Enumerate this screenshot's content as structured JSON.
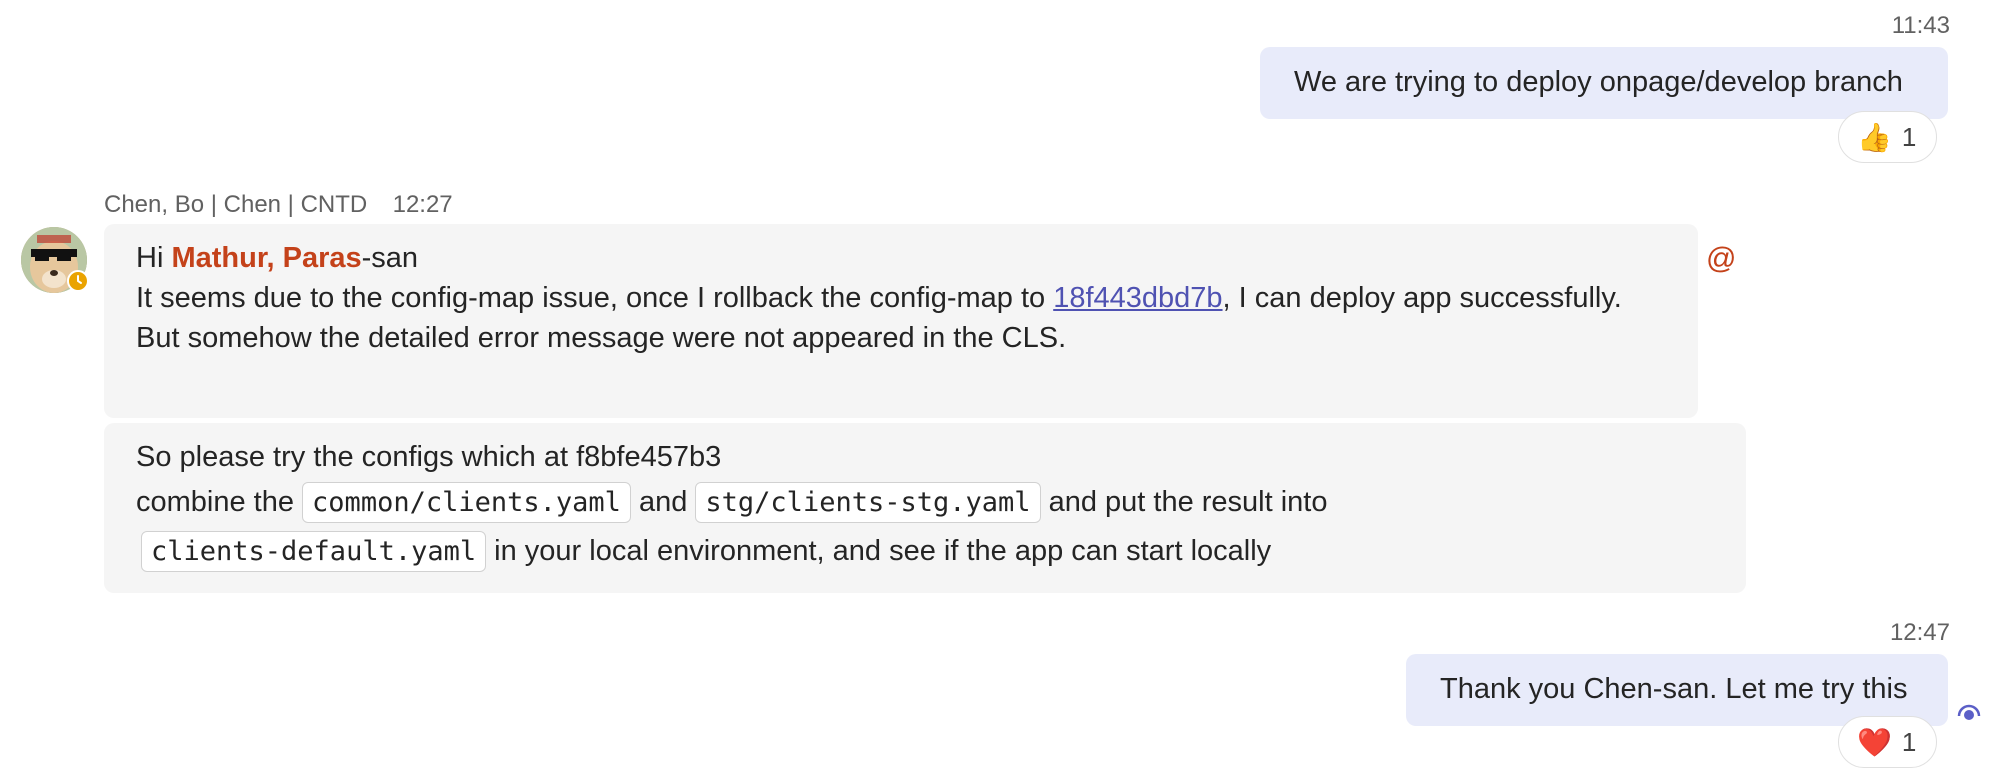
{
  "messages": [
    {
      "time": "11:43",
      "text": "We are trying to deploy onpage/develop branch",
      "reaction": {
        "icon": "thumbs-up-icon",
        "glyph": "👍",
        "count": "1"
      }
    },
    {
      "sender": "Chen, Bo | Chen | CNTD",
      "time": "12:27",
      "greeting_prefix": "Hi ",
      "mention": "Mathur, Paras",
      "greeting_suffix": "-san",
      "line1_before": "It seems due to the config-map issue, once I rollback the config-map to ",
      "link": "18f443dbd7b",
      "line1_after": ", I can deploy app successfully.",
      "line2": "But somehow the detailed error message were not appeared in the CLS.",
      "mention_indicator": "@"
    },
    {
      "line1": "So please try the configs which at f8bfe457b3",
      "line2_a": "combine the ",
      "code1": "common/clients.yaml",
      "line2_b": " and ",
      "code2": "stg/clients-stg.yaml",
      "line2_c": " and put the result into",
      "code3": "clients-default.yaml",
      "line3": " in your local environment, and see if the app can start locally"
    },
    {
      "time": "12:47",
      "text": "Thank you Chen-san. Let me try this",
      "reaction": {
        "icon": "heart-icon",
        "glyph": "❤️",
        "count": "1"
      }
    }
  ],
  "colors": {
    "my_bubble": "#e8ebfa",
    "other_bubble": "#f5f5f5",
    "mention": "#c4421a",
    "link": "#4f52b2",
    "status_away": "#eaa300"
  }
}
